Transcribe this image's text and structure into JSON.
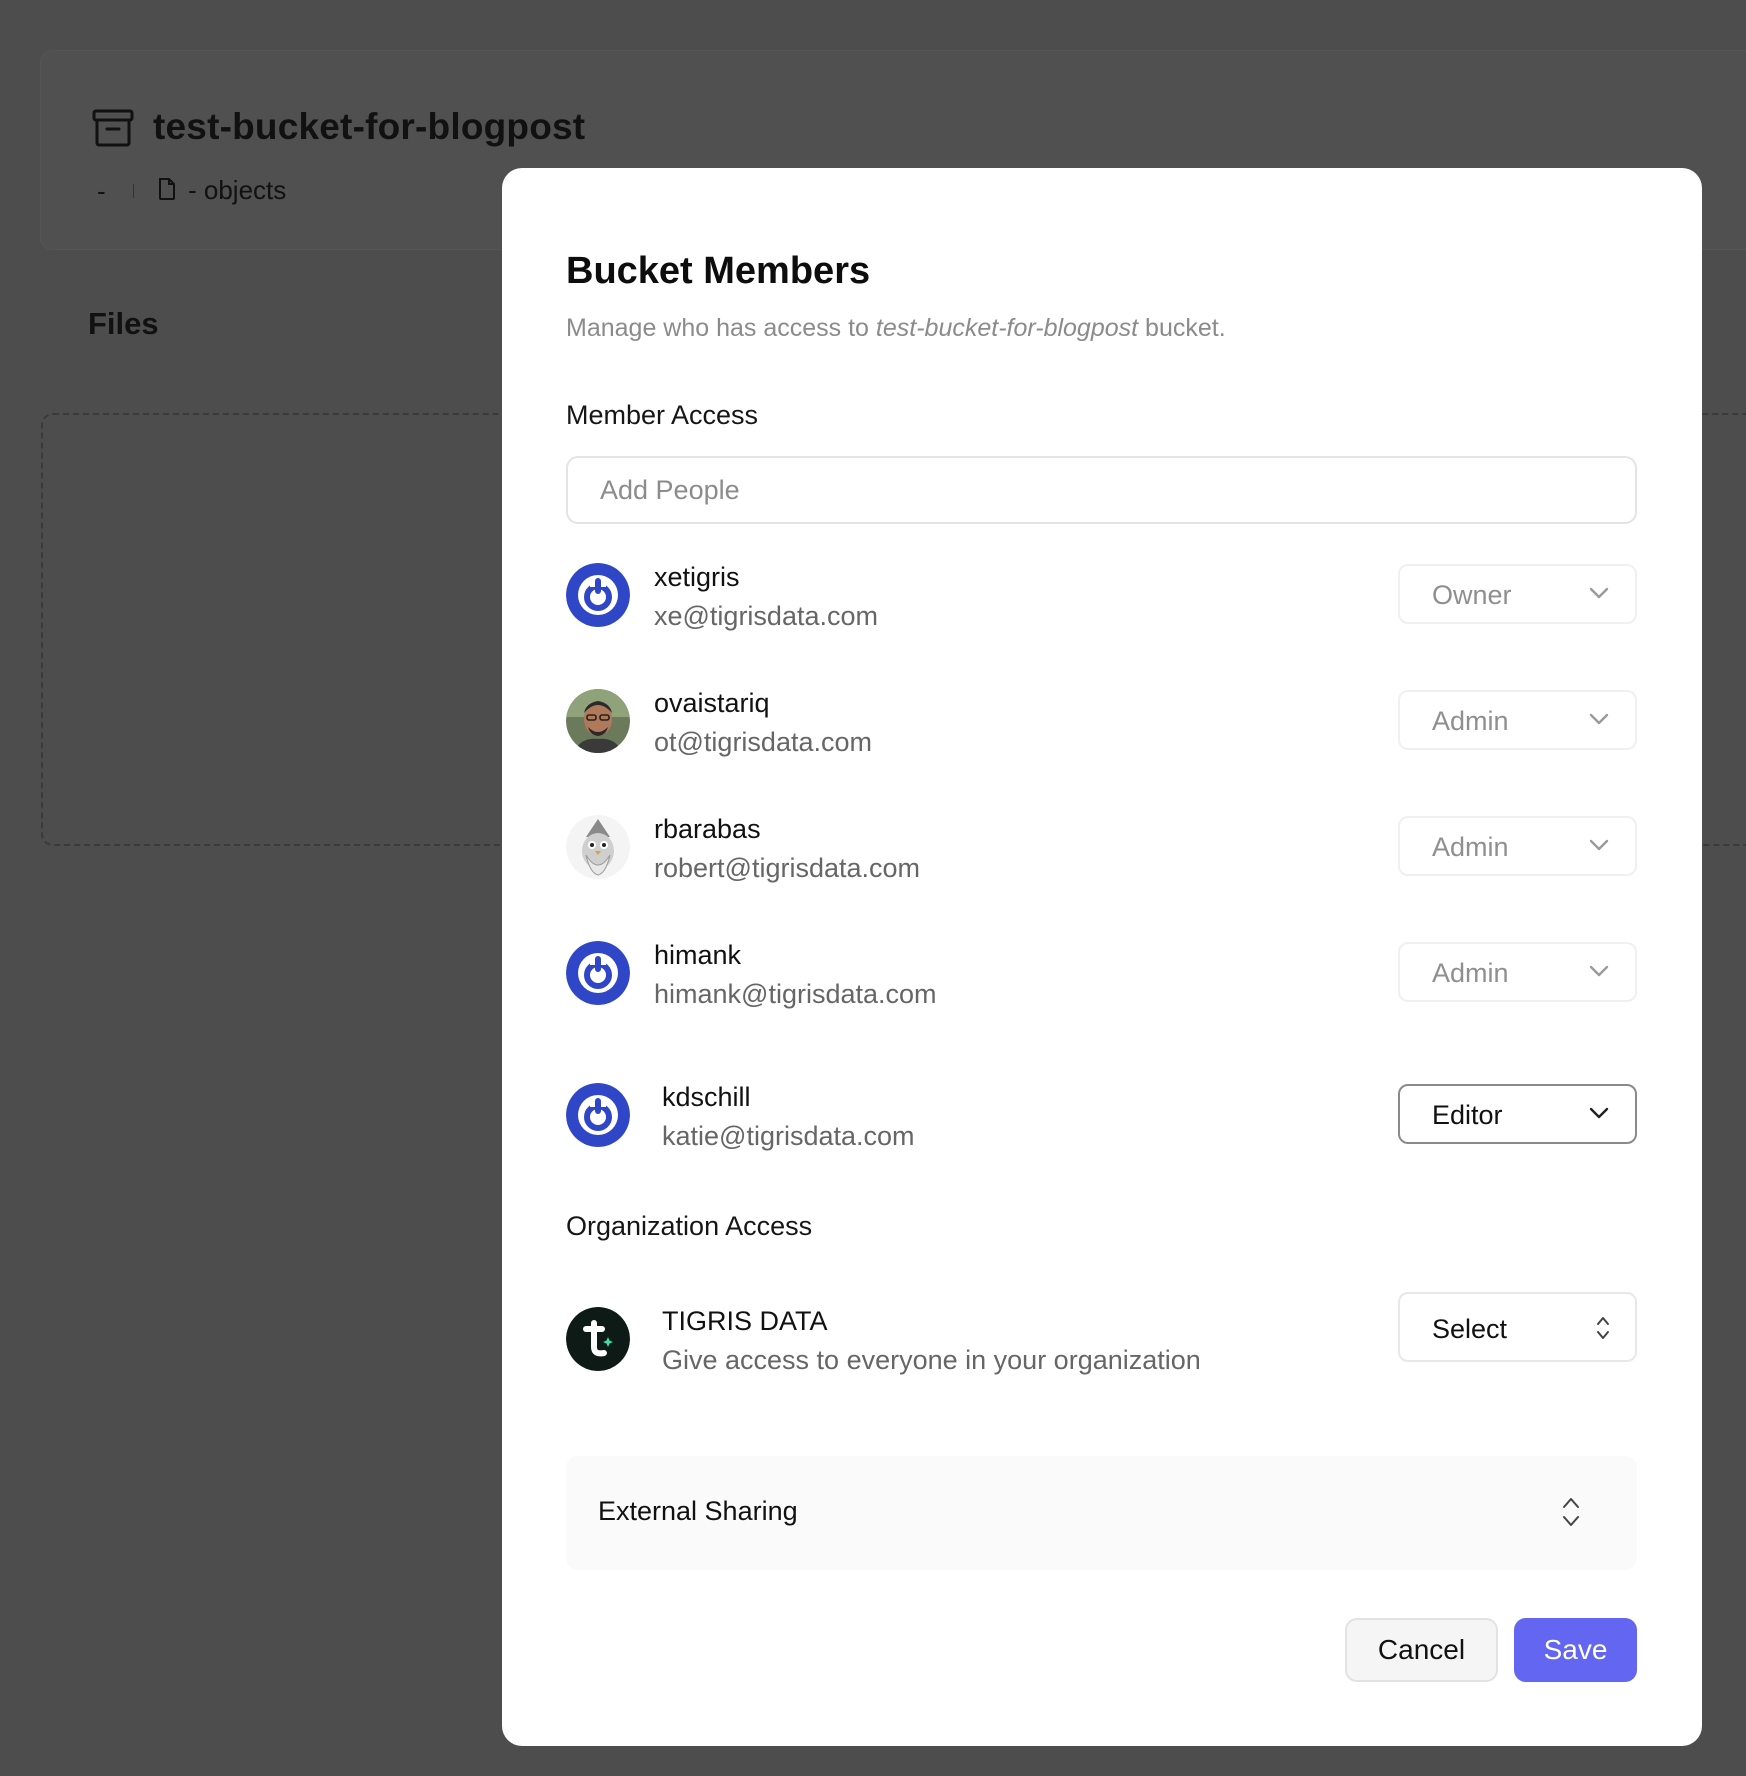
{
  "background": {
    "bucket_title": "test-bucket-for-blogpost",
    "breadcrumb_dash": "-",
    "breadcrumb_objects": "- objects",
    "files_heading": "Files"
  },
  "modal": {
    "title": "Bucket Members",
    "description_prefix": "Manage who has access to",
    "description_bucket": "test-bucket-for-blogpost",
    "description_suffix": "bucket.",
    "member_access_label": "Member Access",
    "add_people_placeholder": "Add People",
    "members": [
      {
        "name": "xetigris",
        "email": "xe@tigrisdata.com",
        "role": "Owner",
        "avatar": "power-icon"
      },
      {
        "name": "ovaistariq",
        "email": "ot@tigrisdata.com",
        "role": "Admin",
        "avatar": "photo-avatar"
      },
      {
        "name": "rbarabas",
        "email": "robert@tigrisdata.com",
        "role": "Admin",
        "avatar": "wizard-avatar"
      },
      {
        "name": "himank",
        "email": "himank@tigrisdata.com",
        "role": "Admin",
        "avatar": "power-icon"
      },
      {
        "name": "kdschill",
        "email": "katie@tigrisdata.com",
        "role": "Editor",
        "avatar": "power-icon"
      }
    ],
    "organization_access_label": "Organization Access",
    "organization": {
      "name": "TIGRIS DATA",
      "description": "Give access to everyone in your organization",
      "select_value": "Select"
    },
    "external_sharing_label": "External Sharing",
    "cancel_label": "Cancel",
    "save_label": "Save"
  },
  "colors": {
    "accent": "#6366f1",
    "avatar_blue": "#2f46c6",
    "backdrop": "#4d4d4d"
  }
}
